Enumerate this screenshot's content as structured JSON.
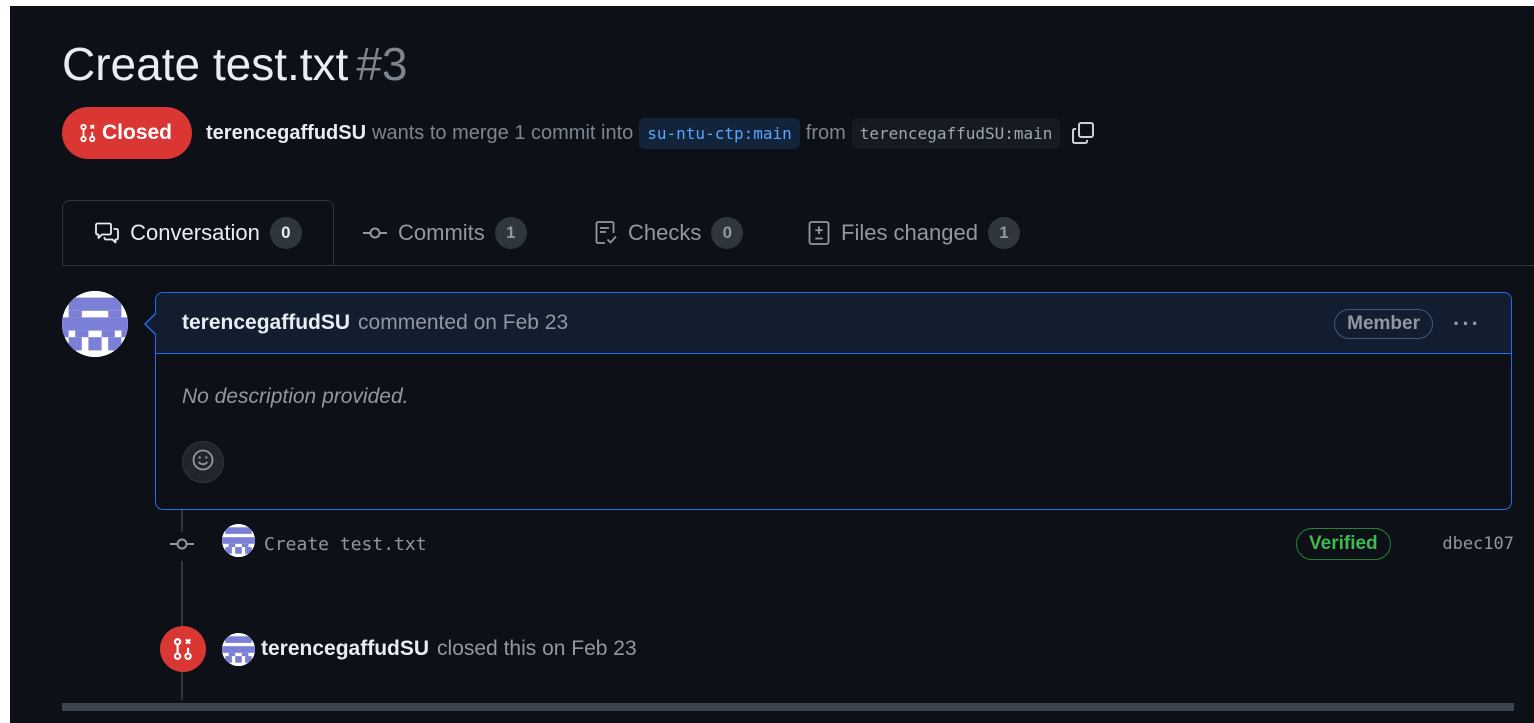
{
  "pr": {
    "title": "Create test.txt",
    "number": "#3",
    "state_label": "Closed",
    "author": "terencegaffudSU",
    "merge_text": "wants to merge 1 commit into",
    "base_branch": "su-ntu-ctp:main",
    "from_text": "from",
    "head_branch": "terencegaffudSU:main"
  },
  "tabs": [
    {
      "label": "Conversation",
      "count": "0",
      "icon": "comment-discussion-icon"
    },
    {
      "label": "Commits",
      "count": "1",
      "icon": "git-commit-icon"
    },
    {
      "label": "Checks",
      "count": "0",
      "icon": "checklist-icon"
    },
    {
      "label": "Files changed",
      "count": "1",
      "icon": "file-diff-icon"
    }
  ],
  "comment": {
    "author": "terencegaffudSU",
    "action": "commented on Feb 23",
    "role_badge": "Member",
    "body": "No description provided."
  },
  "commit": {
    "message": "Create test.txt",
    "verified_label": "Verified",
    "sha": "dbec107"
  },
  "closed_event": {
    "author": "terencegaffudSU",
    "action": "closed this on Feb 23"
  },
  "colors": {
    "background": "#0d1117",
    "closed_red": "#da3633",
    "accent_blue": "#1f6feb",
    "verified_green": "#3fb950",
    "avatar_purple": "#7b7fd6"
  }
}
